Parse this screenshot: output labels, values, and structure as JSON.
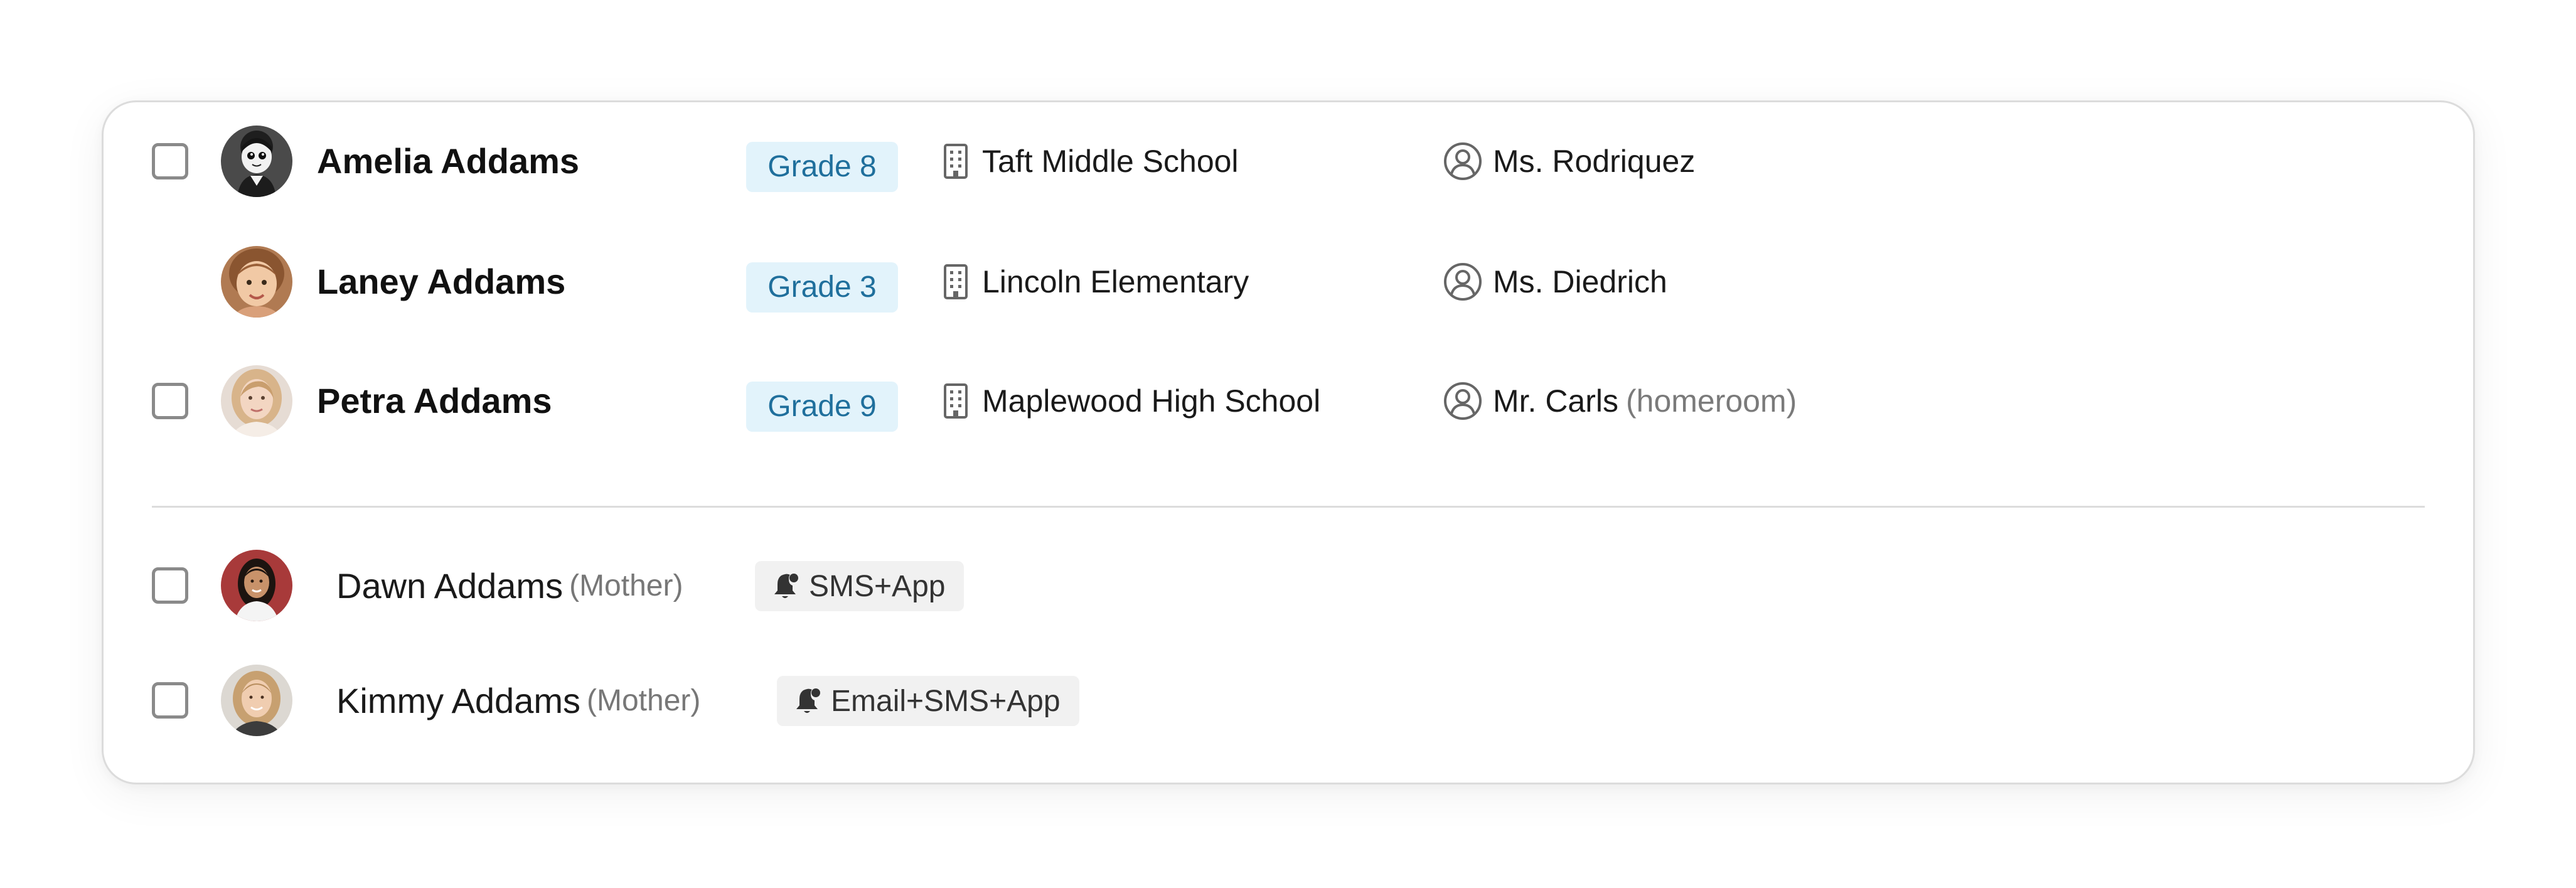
{
  "students": [
    {
      "name": "Amelia Addams",
      "grade": "Grade 8",
      "school": "Taft Middle School",
      "teacher": "Ms. Rodriquez",
      "teacher_note": "",
      "has_checkbox": true,
      "avatar": "cartoon-avatar"
    },
    {
      "name": "Laney Addams",
      "grade": "Grade 3",
      "school": "Lincoln Elementary",
      "teacher": "Ms. Diedrich",
      "teacher_note": "",
      "has_checkbox": false,
      "avatar": "child-photo"
    },
    {
      "name": "Petra Addams",
      "grade": "Grade 9",
      "school": "Maplewood High School",
      "teacher": "Mr. Carls",
      "teacher_note": "(homeroom)",
      "has_checkbox": true,
      "avatar": "teen-photo"
    }
  ],
  "contacts": [
    {
      "name": "Dawn Addams",
      "relation": "(Mother)",
      "notification": "SMS+App",
      "has_checkbox": true,
      "avatar": "adult-photo-dark-hair"
    },
    {
      "name": "Kimmy Addams",
      "relation": "(Mother)",
      "notification": "Email+SMS+App",
      "has_checkbox": true,
      "avatar": "adult-photo-blonde"
    }
  ],
  "icons": {
    "school": "building-icon",
    "teacher": "person-circle-icon",
    "notification": "bell-icon"
  },
  "colors": {
    "grade_badge_bg": "#e2f3fb",
    "grade_badge_text": "#1f6f9c",
    "notify_badge_bg": "#f1f1f1",
    "checkbox_border": "#8a8a8a"
  }
}
